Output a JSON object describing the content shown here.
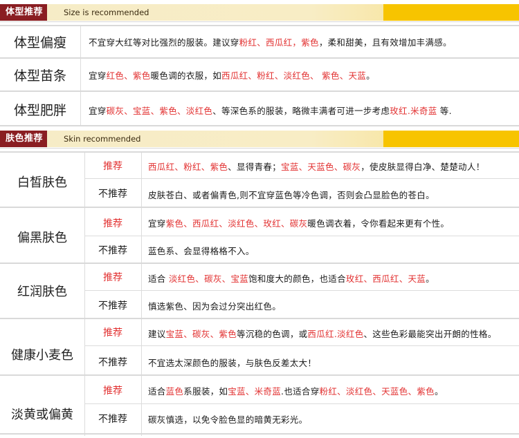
{
  "body_section": {
    "tag": "体型推荐",
    "subtitle": "Size is recommended",
    "rows": [
      {
        "label": "体型偏瘦",
        "segments": [
          {
            "t": "不宜穿大红等对比强烈的服装。建议穿",
            "hl": false
          },
          {
            "t": "粉红、西瓜红，紫色",
            "hl": true
          },
          {
            "t": "，柔和甜美，且有效增加丰满感。",
            "hl": false
          }
        ]
      },
      {
        "label": "体型苗条",
        "segments": [
          {
            "t": "宜穿",
            "hl": false
          },
          {
            "t": "红色、紫色",
            "hl": true
          },
          {
            "t": "暖色调的衣服，如",
            "hl": false
          },
          {
            "t": "西瓜红、粉红、淡红色、 紫色、天蓝",
            "hl": true
          },
          {
            "t": "。",
            "hl": false
          }
        ]
      },
      {
        "label": "体型肥胖",
        "segments": [
          {
            "t": "宜穿",
            "hl": false
          },
          {
            "t": "碳灰、宝蓝、紫色、淡红色",
            "hl": true
          },
          {
            "t": "、等深色系的服装，略微丰满者可进一步考虑",
            "hl": false
          },
          {
            "t": "玫红.米奇蓝",
            "hl": true
          },
          {
            "t": " 等.",
            "hl": false
          }
        ]
      }
    ]
  },
  "skin_section": {
    "tag": "肤色推荐",
    "subtitle": "Skin recommended",
    "recommend_label": "推荐",
    "not_recommend_label": "不推荐",
    "rows": [
      {
        "label": "白皙肤色",
        "rec": [
          {
            "t": "西瓜红、粉红、紫色",
            "hl": true
          },
          {
            "t": "、显得青春；",
            "hl": false
          },
          {
            "t": "宝蓝、天蓝色、碳灰",
            "hl": true
          },
          {
            "t": "，使皮肤显得白净、楚楚动人！",
            "hl": false
          }
        ],
        "notrec": "皮肤苍白、或者偏青色,则不宜穿蓝色等冷色调，否则会凸显脸色的苍白。"
      },
      {
        "label": "偏黑肤色",
        "rec": [
          {
            "t": "宜穿",
            "hl": false
          },
          {
            "t": "紫色、西瓜红、淡红色、玫红、碳灰",
            "hl": true
          },
          {
            "t": "暖色调衣着，令你看起来更有个性。",
            "hl": false
          }
        ],
        "notrec": "蓝色系、会显得格格不入。"
      },
      {
        "label": "红润肤色",
        "rec": [
          {
            "t": "适合 ",
            "hl": false
          },
          {
            "t": "淡红色、碳灰、宝蓝",
            "hl": true
          },
          {
            "t": "饱和度大的颜色，也适合",
            "hl": false
          },
          {
            "t": "玫红、西瓜红、天蓝",
            "hl": true
          },
          {
            "t": "。",
            "hl": false
          }
        ],
        "notrec": "慎选紫色、因为会过分突出红色。"
      },
      {
        "label": "健康小麦色",
        "rec": [
          {
            "t": "建议",
            "hl": false
          },
          {
            "t": "宝蓝、碳灰、紫色",
            "hl": true
          },
          {
            "t": "等沉稳的色调，或",
            "hl": false
          },
          {
            "t": "西瓜红.淡红色",
            "hl": true
          },
          {
            "t": "、这些色彩最能突出开朗的性格。",
            "hl": false
          }
        ],
        "notrec": "不宜选太深颜色的服装，与肤色反差太大！"
      },
      {
        "label": "淡黄或偏黄",
        "rec": [
          {
            "t": "适合",
            "hl": false
          },
          {
            "t": "蓝色",
            "hl": true
          },
          {
            "t": "系服装，如",
            "hl": false
          },
          {
            "t": "宝蓝、米奇蓝",
            "hl": true
          },
          {
            "t": ".也适合穿",
            "hl": false
          },
          {
            "t": "粉红、淡红色、天蓝色、紫色",
            "hl": true
          },
          {
            "t": "。",
            "hl": false
          }
        ],
        "notrec": "碳灰慎选，以免令脸色显的暗黄无彩光。"
      }
    ]
  },
  "colors": {
    "highlight": "#e23131",
    "tag_bg": "#8a1e22",
    "header_bar": "#f6ecc7",
    "header_gold": "#f7c400"
  }
}
